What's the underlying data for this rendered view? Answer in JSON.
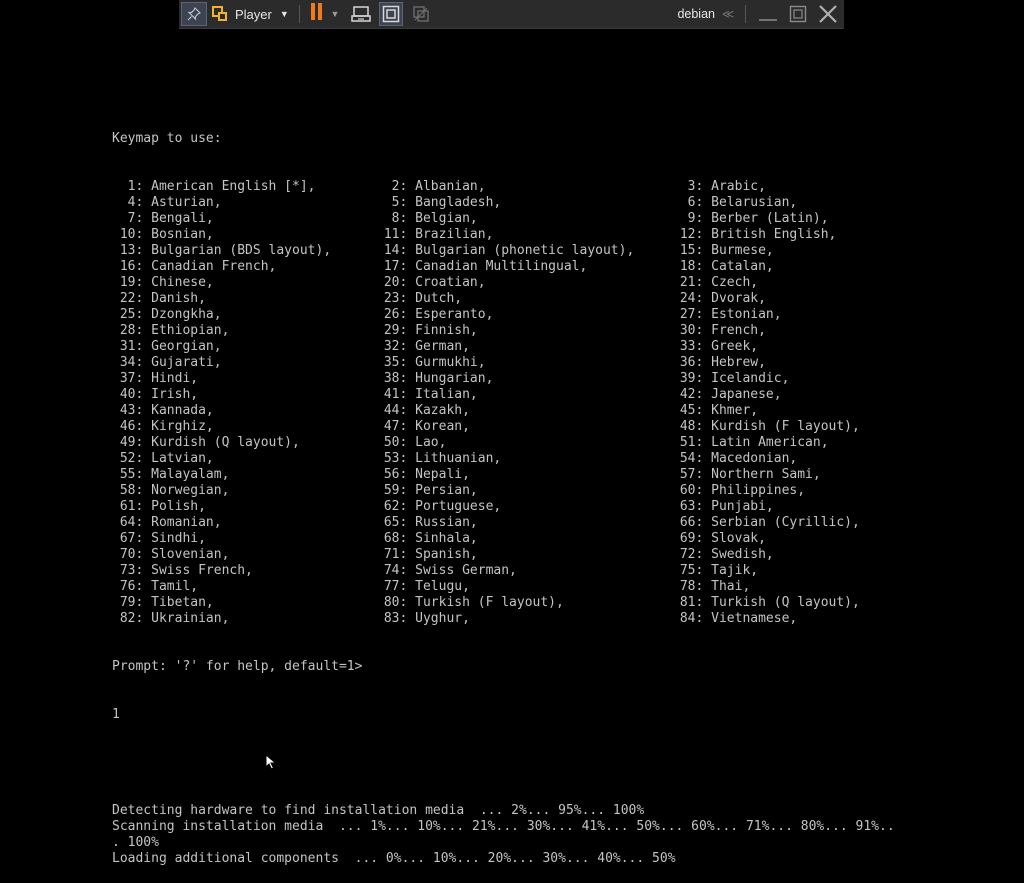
{
  "toolbar": {
    "player_label": "Player",
    "vm_name": "debian",
    "collapse_glyph": "≪",
    "icons": [
      "pin-icon",
      "vmware-logo-icon",
      "pause-icon",
      "send-ctrl-alt-del-icon",
      "fit-guest-icon",
      "unity-icon",
      "minimize-icon",
      "restore-icon",
      "close-icon"
    ],
    "accent_pause": "#f07b1d"
  },
  "console": {
    "header": "Keymap to use:",
    "keymap_rows": [
      [
        "  1: American English [*],",
        "  2: Albanian,",
        "  3: Arabic,"
      ],
      [
        "  4: Asturian,",
        "  5: Bangladesh,",
        "  6: Belarusian,"
      ],
      [
        "  7: Bengali,",
        "  8: Belgian,",
        "  9: Berber (Latin),"
      ],
      [
        " 10: Bosnian,",
        " 11: Brazilian,",
        " 12: British English,"
      ],
      [
        " 13: Bulgarian (BDS layout),",
        " 14: Bulgarian (phonetic layout),",
        " 15: Burmese,"
      ],
      [
        " 16: Canadian French,",
        " 17: Canadian Multilingual,",
        " 18: Catalan,"
      ],
      [
        " 19: Chinese,",
        " 20: Croatian,",
        " 21: Czech,"
      ],
      [
        " 22: Danish,",
        " 23: Dutch,",
        " 24: Dvorak,"
      ],
      [
        " 25: Dzongkha,",
        " 26: Esperanto,",
        " 27: Estonian,"
      ],
      [
        " 28: Ethiopian,",
        " 29: Finnish,",
        " 30: French,"
      ],
      [
        " 31: Georgian,",
        " 32: German,",
        " 33: Greek,"
      ],
      [
        " 34: Gujarati,",
        " 35: Gurmukhi,",
        " 36: Hebrew,"
      ],
      [
        " 37: Hindi,",
        " 38: Hungarian,",
        " 39: Icelandic,"
      ],
      [
        " 40: Irish,",
        " 41: Italian,",
        " 42: Japanese,"
      ],
      [
        " 43: Kannada,",
        " 44: Kazakh,",
        " 45: Khmer,"
      ],
      [
        " 46: Kirghiz,",
        " 47: Korean,",
        " 48: Kurdish (F layout),"
      ],
      [
        " 49: Kurdish (Q layout),",
        " 50: Lao,",
        " 51: Latin American,"
      ],
      [
        " 52: Latvian,",
        " 53: Lithuanian,",
        " 54: Macedonian,"
      ],
      [
        " 55: Malayalam,",
        " 56: Nepali,",
        " 57: Northern Sami,"
      ],
      [
        " 58: Norwegian,",
        " 59: Persian,",
        " 60: Philippines,"
      ],
      [
        " 61: Polish,",
        " 62: Portuguese,",
        " 63: Punjabi,"
      ],
      [
        " 64: Romanian,",
        " 65: Russian,",
        " 66: Serbian (Cyrillic),"
      ],
      [
        " 67: Sindhi,",
        " 68: Sinhala,",
        " 69: Slovak,"
      ],
      [
        " 70: Slovenian,",
        " 71: Spanish,",
        " 72: Swedish,"
      ],
      [
        " 73: Swiss French,",
        " 74: Swiss German,",
        " 75: Tajik,"
      ],
      [
        " 76: Tamil,",
        " 77: Telugu,",
        " 78: Thai,"
      ],
      [
        " 79: Tibetan,",
        " 80: Turkish (F layout),",
        " 81: Turkish (Q layout),"
      ],
      [
        " 82: Ukrainian,",
        " 83: Uyghur,",
        " 84: Vietnamese,"
      ]
    ],
    "prompt": "Prompt: '?' for help, default=1>",
    "input": "1",
    "log_lines": [
      "Detecting hardware to find installation media  ... 2%... 95%... 100%",
      "Scanning installation media  ... 1%... 10%... 21%... 30%... 41%... 50%... 60%... 71%... 80%... 91%..",
      ". 100%",
      "Loading additional components  ... 0%... 10%... 20%... 30%... 40%... 50%"
    ]
  }
}
